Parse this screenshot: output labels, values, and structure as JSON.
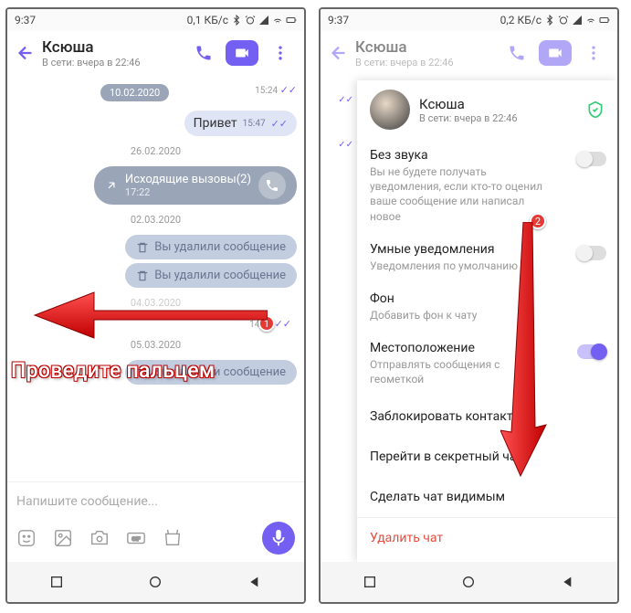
{
  "statusbar": {
    "time": "9:37",
    "net": "0,1 КБ/с",
    "net2": "0,2 КБ/с"
  },
  "header": {
    "name": "Ксюша",
    "status": "В сети: вчера в 22:46"
  },
  "chat": {
    "date1": "10.02.2020",
    "time1": "15:24",
    "msg1": "Привет",
    "msg1_time": "15:47",
    "date2": "26.02.2020",
    "call_label": "Исходящие вызовы(2)",
    "call_time": "17:22",
    "date3": "02.03.2020",
    "deleted": "Вы удалили сообщение",
    "date4": "04.03.2020",
    "time4": "14:39",
    "date5": "05.03.2020",
    "placeholder": "Напишите сообщение..."
  },
  "profile": {
    "name": "Ксюша",
    "status": "В сети: вчера в 22:46",
    "mute_title": "Без звука",
    "mute_desc": "Вы не будете получать уведомления, если кто-то оценил ваше сообщение или написал новое",
    "smart_title": "Умные уведомления",
    "smart_desc": "Уведомления по умолчанию",
    "bg_title": "Фон",
    "bg_desc": "Добавить фон к чату",
    "loc_title": "Местоположение",
    "loc_desc": "Отправлять сообщения с геометкой",
    "block": "Заблокировать контакт",
    "secret": "Перейти в секретный чат",
    "visible": "Сделать чат видимым",
    "delete": "Удалить чат"
  },
  "overlay": {
    "swipe": "Проведите пальцем",
    "badge1": "1",
    "badge2": "2"
  }
}
